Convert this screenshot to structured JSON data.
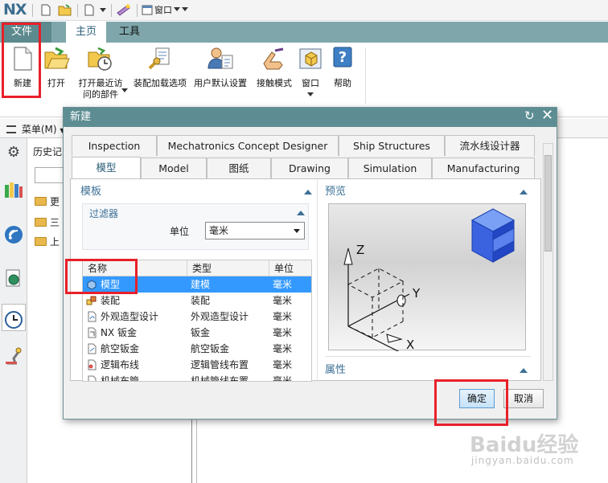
{
  "app": {
    "logo": "NX",
    "window_menu": "窗口"
  },
  "ribbon": {
    "tabs": {
      "file": "文件(F)",
      "home": "主页",
      "tools": "工具"
    },
    "buttons": {
      "new": "新建",
      "open": "打开",
      "recent_l1": "打开最近访",
      "recent_l2": "问的部件",
      "assembly": "装配加载选项",
      "user_defaults": "用户默认设置",
      "touch": "接触模式",
      "window": "窗口",
      "help": "帮助"
    }
  },
  "toolbar2": {
    "menu": "菜单(M)"
  },
  "navigator": {
    "title": "历史记",
    "rows": [
      "更",
      "三",
      "上"
    ]
  },
  "dialog": {
    "title": "新建",
    "tabs_row1": [
      "Inspection",
      "Mechatronics Concept Designer",
      "Ship Structures",
      "流水线设计器"
    ],
    "tabs_row2": [
      "模型",
      "Model",
      "图纸",
      "Drawing",
      "Simulation",
      "Manufacturing"
    ],
    "template_section": "模板",
    "filter_section": "过滤器",
    "unit_label": "单位",
    "unit_value": "毫米",
    "columns": {
      "name": "名称",
      "type": "类型",
      "unit": "单位"
    },
    "rows": [
      {
        "name": "模型",
        "type": "建模",
        "unit": "毫米"
      },
      {
        "name": "装配",
        "type": "装配",
        "unit": "毫米"
      },
      {
        "name": "外观造型设计",
        "type": "外观造型设计",
        "unit": "毫米"
      },
      {
        "name": "NX 钣金",
        "type": "钣金",
        "unit": "毫米"
      },
      {
        "name": "航空钣金",
        "type": "航空钣金",
        "unit": "毫米"
      },
      {
        "name": "逻辑布线",
        "type": "逻辑管线布置",
        "unit": "毫米"
      },
      {
        "name": "机械布管",
        "type": "机械管线布置",
        "unit": "毫米"
      }
    ],
    "preview_section": "预览",
    "preview_axes": {
      "z": "Z",
      "y": "Y",
      "x": "X"
    },
    "properties_section": "属性",
    "ok": "确定",
    "cancel": "取消"
  },
  "watermark": {
    "brand": "Baidu经验",
    "url": "jingyan.baidu.com"
  },
  "colors": {
    "title_bar": "#5d8d93",
    "ribbon_tab_bar": "#7fa7ab",
    "selection": "#3399ff",
    "highlight_box": "#e8202a",
    "section_header": "#3d7096"
  }
}
